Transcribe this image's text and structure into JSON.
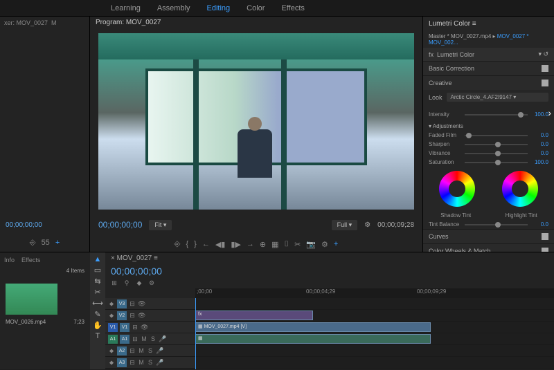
{
  "workspace_tabs": [
    "Learning",
    "Assembly",
    "Editing",
    "Color",
    "Effects"
  ],
  "workspace_active": "Editing",
  "left_panel": {
    "tab": "xer: MOV_0027",
    "markers": "M",
    "tc": "00;00;00;00"
  },
  "program": {
    "tab": "Program: MOV_0027",
    "tc_in": "00;00;00;00",
    "fit": "Fit",
    "full": "Full",
    "tc_out": "00;00;09;28"
  },
  "transport_icons": [
    "⎆",
    "{",
    "}",
    "←",
    "◀▮",
    "▮▶",
    "→",
    "⊕",
    "▦",
    "⌷",
    "✂",
    "📷",
    "⚙"
  ],
  "lumetri": {
    "title": "Lumetri Color",
    "breadcrumb_a": "Master * MOV_0027.mp4",
    "breadcrumb_b": "MOV_0027 * MOV_002...",
    "fx": "fx",
    "fx_name": "Lumetri Color",
    "sections": {
      "basic": "Basic Correction",
      "creative": "Creative",
      "look_label": "Look",
      "look_value": "Arctic Circle_4.AF2I9147",
      "intensity_label": "Intensity",
      "intensity_val": "100.0",
      "adjustments": "Adjustments",
      "faded_label": "Faded Film",
      "faded_val": "0.0",
      "sharpen_label": "Sharpen",
      "sharpen_val": "0.0",
      "vibrance_label": "Vibrance",
      "vibrance_val": "0.0",
      "saturation_label": "Saturation",
      "saturation_val": "100.0",
      "shadow_tint": "Shadow Tint",
      "highlight_tint": "Highlight Tint",
      "tint_balance": "Tint Balance",
      "tint_val": "0.0",
      "curves": "Curves",
      "colorwheels": "Color Wheels & Match"
    }
  },
  "project": {
    "tabs": [
      "Info",
      "Effects"
    ],
    "count": "4 Items",
    "clip_name": "MOV_0026.mp4",
    "clip_dur": "7;23"
  },
  "tools": [
    "▲",
    "▭",
    "⇆",
    "✂",
    "⟷",
    "✎",
    "✋",
    "T"
  ],
  "timeline": {
    "tab": "MOV_0027",
    "tc": "00;00;00;00",
    "ruler": [
      ";00;00",
      "00;00;04;29",
      "00;00;09;29"
    ],
    "tracks": [
      {
        "name": "V3"
      },
      {
        "name": "V2"
      },
      {
        "name": "V1"
      },
      {
        "name": "A1"
      },
      {
        "name": "A2"
      },
      {
        "name": "A3"
      }
    ],
    "clip_label": "MOV_0027.mp4 [V]"
  }
}
